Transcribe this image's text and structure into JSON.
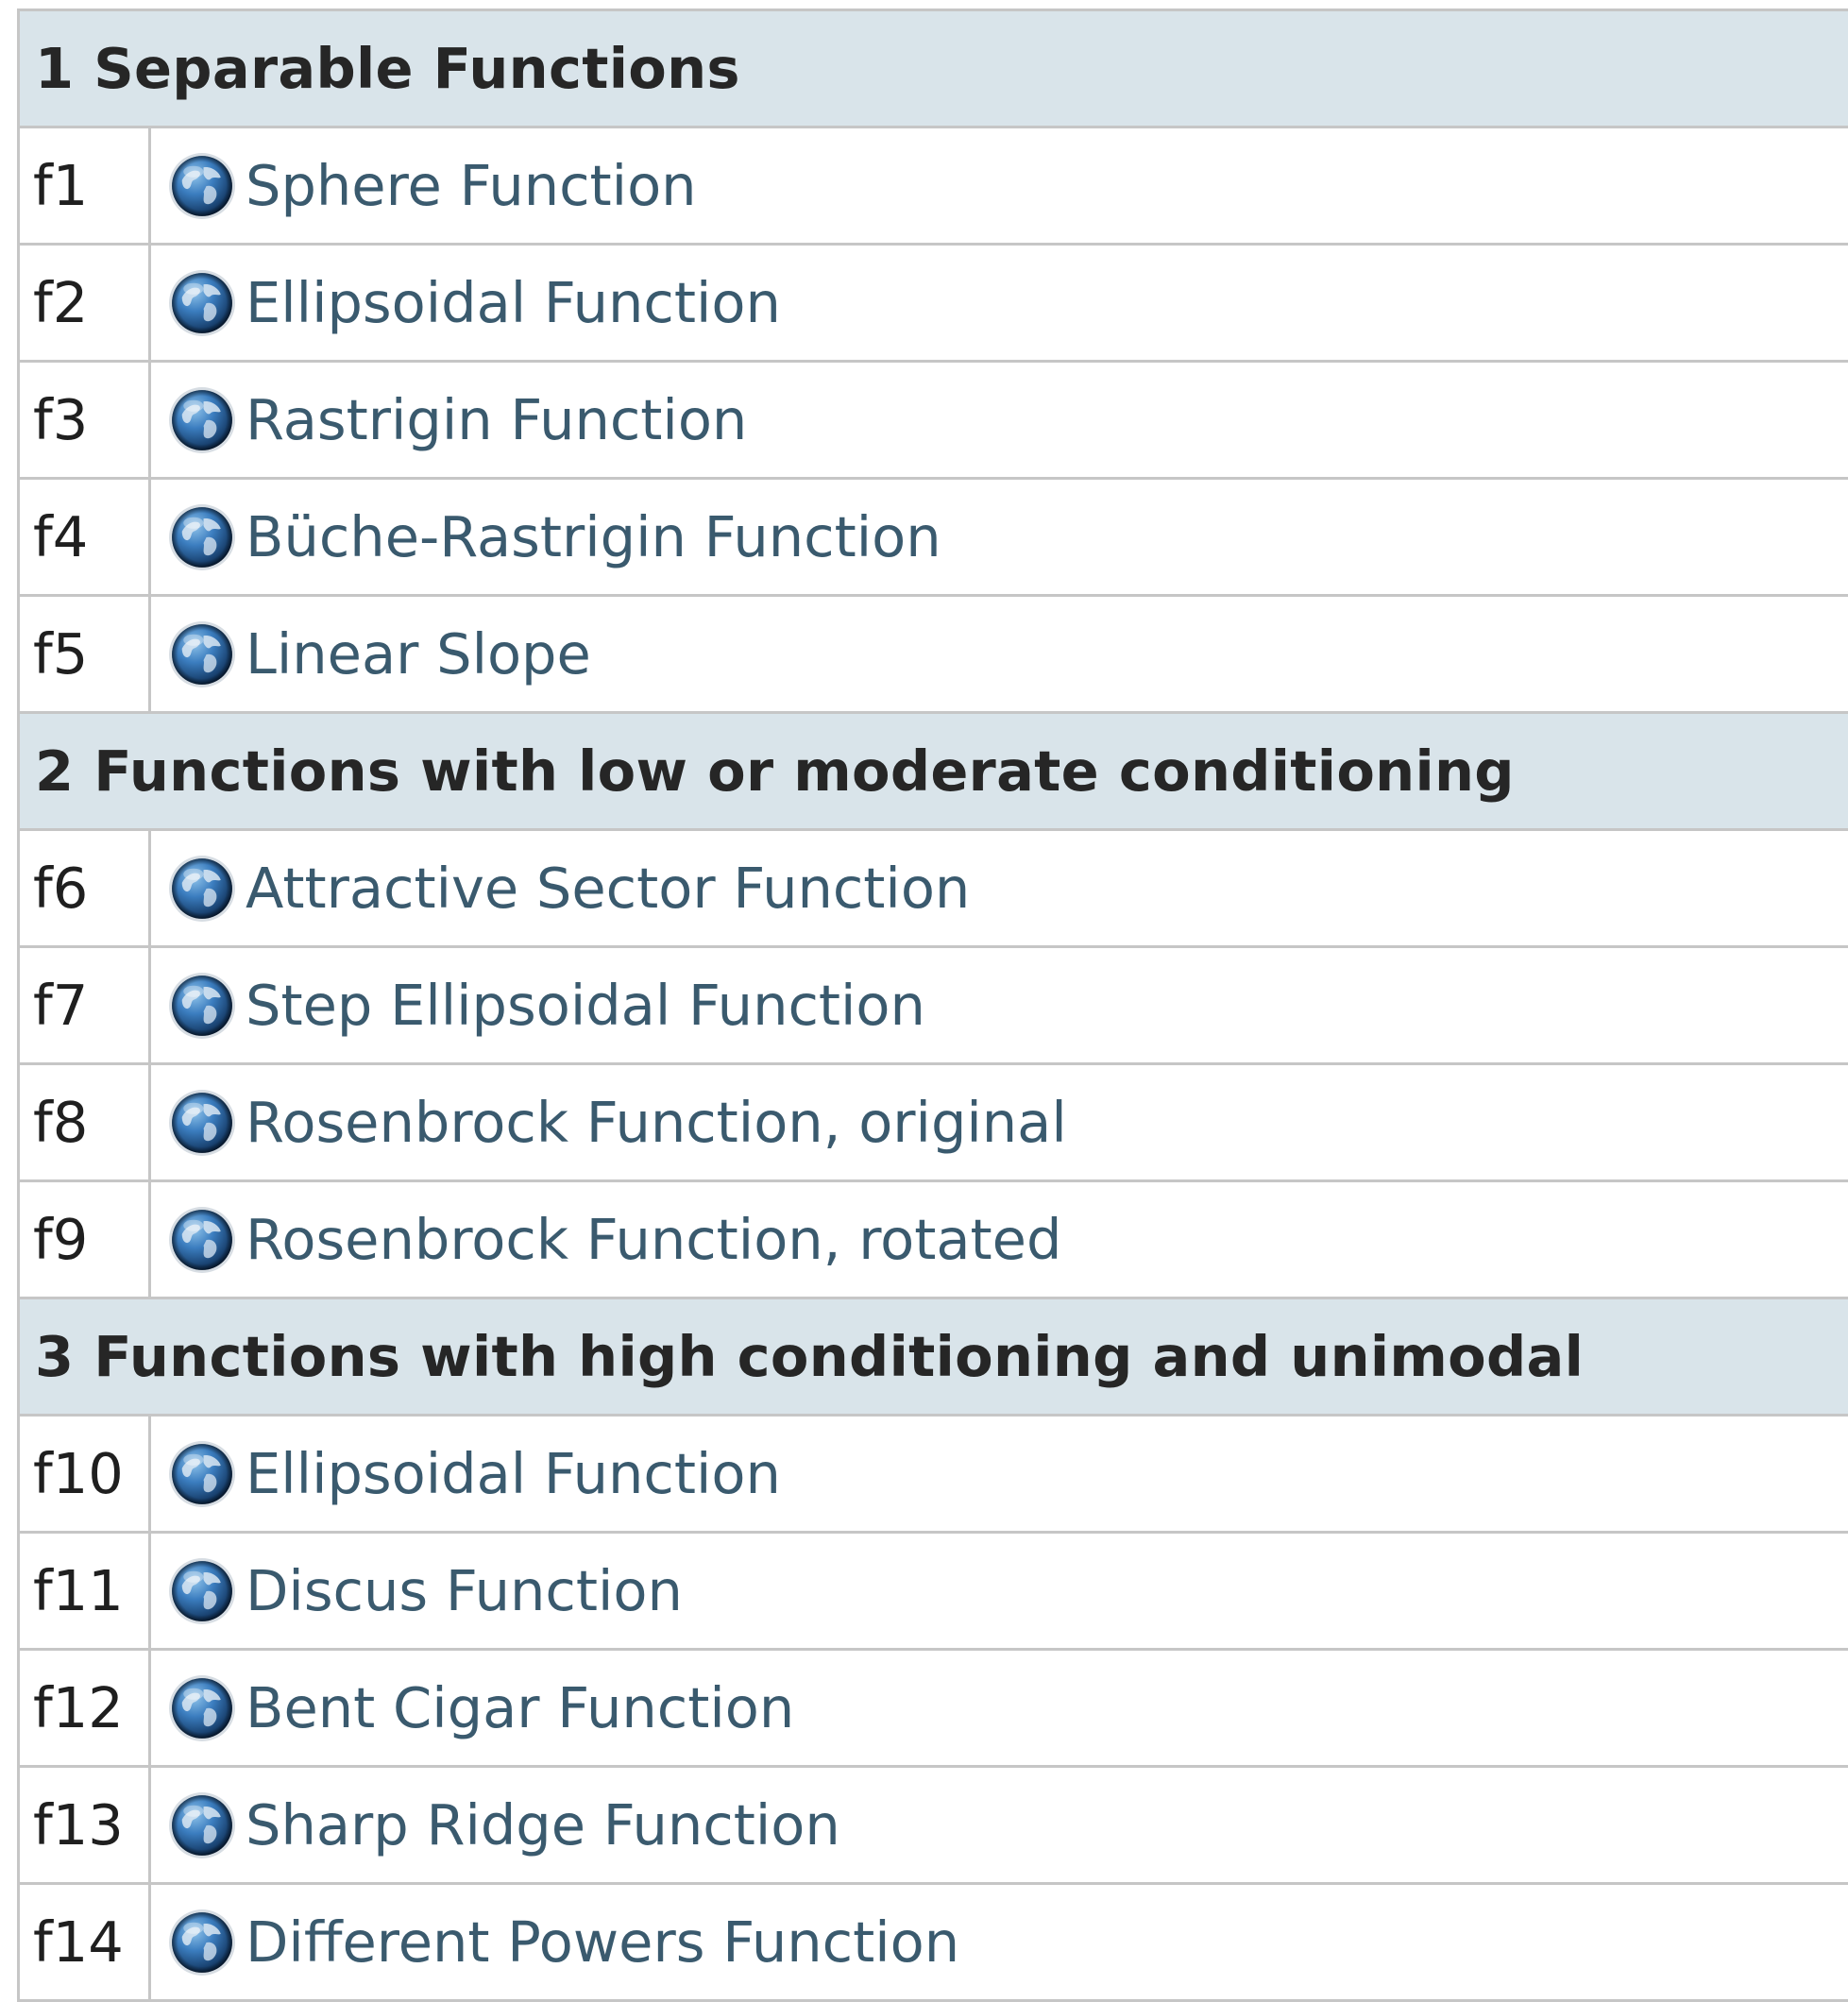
{
  "colors": {
    "section_bg": "#d9e4ea",
    "border": "#c6c6c6",
    "link": "#3a5a6e",
    "text": "#1f1f1f"
  },
  "icon": "globe-icon",
  "sections": [
    {
      "title": "1 Separable Functions",
      "rows": [
        {
          "id": "f1",
          "name": "Sphere Function"
        },
        {
          "id": "f2",
          "name": "Ellipsoidal Function"
        },
        {
          "id": "f3",
          "name": "Rastrigin Function"
        },
        {
          "id": "f4",
          "name": "Büche-Rastrigin Function"
        },
        {
          "id": "f5",
          "name": "Linear Slope"
        }
      ]
    },
    {
      "title": "2 Functions with low or moderate conditioning",
      "rows": [
        {
          "id": "f6",
          "name": "Attractive Sector Function"
        },
        {
          "id": "f7",
          "name": "Step Ellipsoidal Function"
        },
        {
          "id": "f8",
          "name": "Rosenbrock Function, original"
        },
        {
          "id": "f9",
          "name": "Rosenbrock Function, rotated"
        }
      ]
    },
    {
      "title": "3 Functions with high conditioning and unimodal",
      "rows": [
        {
          "id": "f10",
          "name": "Ellipsoidal Function"
        },
        {
          "id": "f11",
          "name": "Discus Function"
        },
        {
          "id": "f12",
          "name": "Bent Cigar Function"
        },
        {
          "id": "f13",
          "name": "Sharp Ridge Function"
        },
        {
          "id": "f14",
          "name": "Different Powers Function"
        }
      ]
    }
  ]
}
